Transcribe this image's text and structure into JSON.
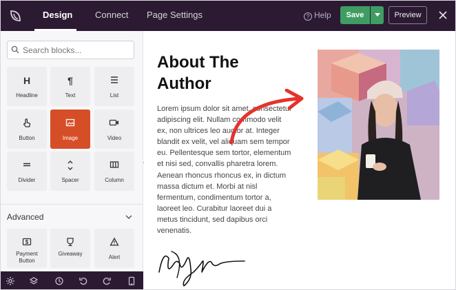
{
  "topbar": {
    "tabs": [
      {
        "label": "Design",
        "active": true
      },
      {
        "label": "Connect",
        "active": false
      },
      {
        "label": "Page Settings",
        "active": false
      }
    ],
    "help_label": "Help",
    "save_label": "Save",
    "preview_label": "Preview",
    "colors": {
      "bar": "#2c1a33",
      "save": "#3f9d64"
    }
  },
  "sidebar": {
    "search": {
      "placeholder": "Search blocks...",
      "value": ""
    },
    "blocks": [
      {
        "label": "Headline",
        "icon": "heading-icon"
      },
      {
        "label": "Text",
        "icon": "paragraph-icon"
      },
      {
        "label": "List",
        "icon": "list-icon"
      },
      {
        "label": "Button",
        "icon": "pointer-icon"
      },
      {
        "label": "Image",
        "icon": "image-icon",
        "selected": true
      },
      {
        "label": "Video",
        "icon": "video-icon"
      },
      {
        "label": "Divider",
        "icon": "divider-icon"
      },
      {
        "label": "Spacer",
        "icon": "spacer-icon"
      },
      {
        "label": "Column",
        "icon": "column-icon"
      }
    ],
    "advanced": {
      "title": "Advanced",
      "blocks": [
        {
          "label_line1": "Payment",
          "label_line2": "Button",
          "icon": "dollar-icon"
        },
        {
          "label": "Giveaway",
          "icon": "trophy-icon"
        },
        {
          "label": "Alert",
          "icon": "alert-icon"
        }
      ]
    },
    "accent": "#d64e28"
  },
  "bottom_toolbar": [
    "settings-icon",
    "layers-icon",
    "history-icon",
    "undo-icon",
    "redo-icon",
    "mobile-preview-icon"
  ],
  "canvas": {
    "heading_line1": "About The",
    "heading_line2": "Author",
    "body": "Lorem ipsum dolor sit amet, consectetur adipiscing elit. Nullam commodo velit ex, non ultrices leo auctor at. Integer blandit ex velit, vel aliquam sem tempor eu. Pellentesque sem tortor, elementum et nisi sed, convallis pharetra lorem. Aenean rhoncus rhoncus ex, in dictum massa dictum et. Morbi at nisl fermentum, condimentum tortor a, laoreet leo. Curabitur laoreet dui a metus tincidunt, sed dapibus orci venenatis."
  }
}
